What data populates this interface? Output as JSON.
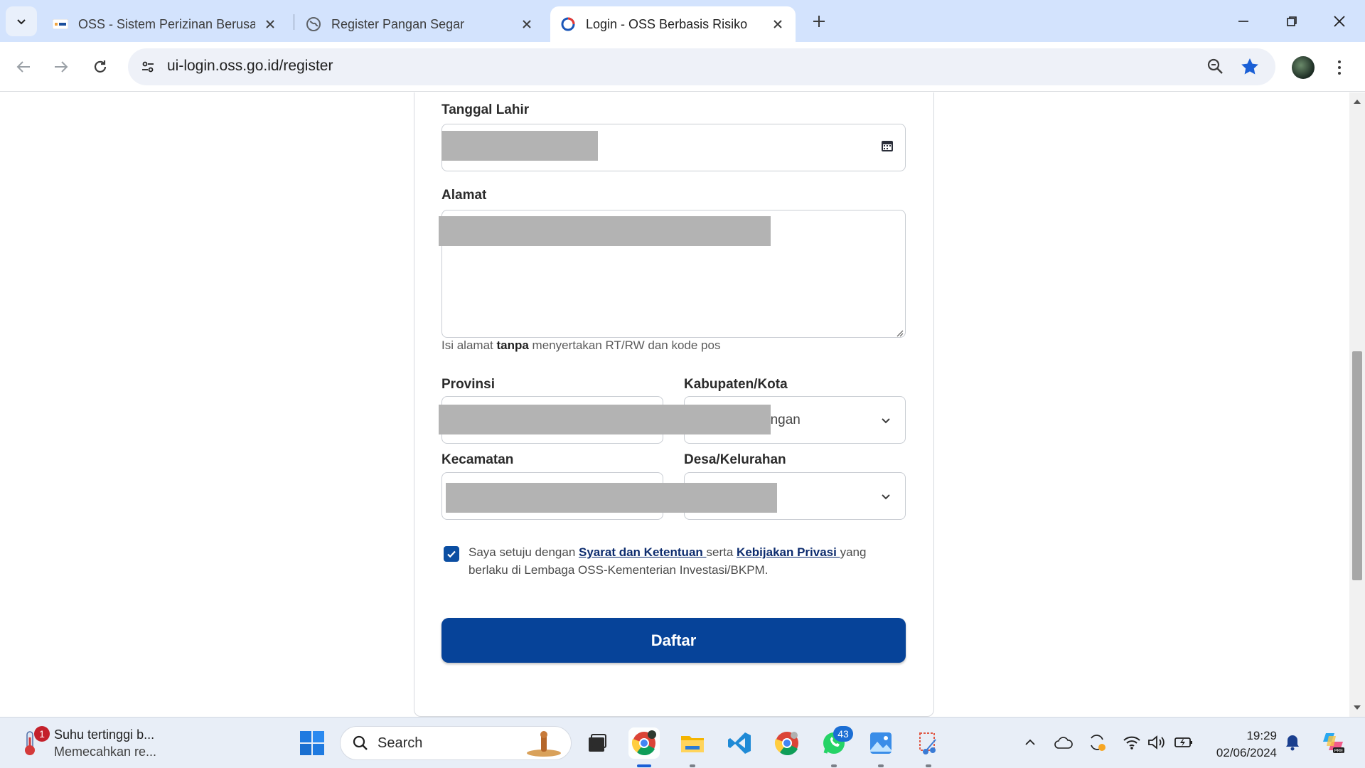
{
  "browser": {
    "tabs": [
      {
        "title": "OSS - Sistem Perizinan Berusaha",
        "active": false
      },
      {
        "title": "Register Pangan Segar",
        "active": false
      },
      {
        "title": "Login - OSS Berbasis Risiko",
        "active": true
      }
    ],
    "url": "ui-login.oss.go.id/register"
  },
  "form": {
    "tanggal_lahir": {
      "label": "Tanggal Lahir"
    },
    "alamat": {
      "label": "Alamat",
      "helper_pre": "Isi alamat ",
      "helper_bold": "tanpa",
      "helper_post": " menyertakan RT/RW dan kode pos"
    },
    "provinsi": {
      "label": "Provinsi"
    },
    "kabupaten": {
      "label": "Kabupaten/Kota",
      "visible_value_fragment": "ongan"
    },
    "kecamatan": {
      "label": "Kecamatan"
    },
    "desa": {
      "label": "Desa/Kelurahan"
    },
    "agreement": {
      "checked": true,
      "pre": "Saya setuju dengan ",
      "link1": "Syarat dan Ketentuan ",
      "mid": "serta ",
      "link2": "Kebijakan Privasi ",
      "post": "yang berlaku di Lembaga OSS-Kementerian Investasi/BKPM."
    },
    "submit_label": "Daftar"
  },
  "taskbar": {
    "weather_title": "Suhu tertinggi b...",
    "weather_sub": "Memecahkan re...",
    "weather_badge": "1",
    "search_label": "Search",
    "whatsapp_badge": "43",
    "time": "19:29",
    "date": "02/06/2024"
  },
  "colors": {
    "primary_button": "#064399",
    "checkbox": "#0b4ea2",
    "tabstrip": "#d3e3fd"
  }
}
